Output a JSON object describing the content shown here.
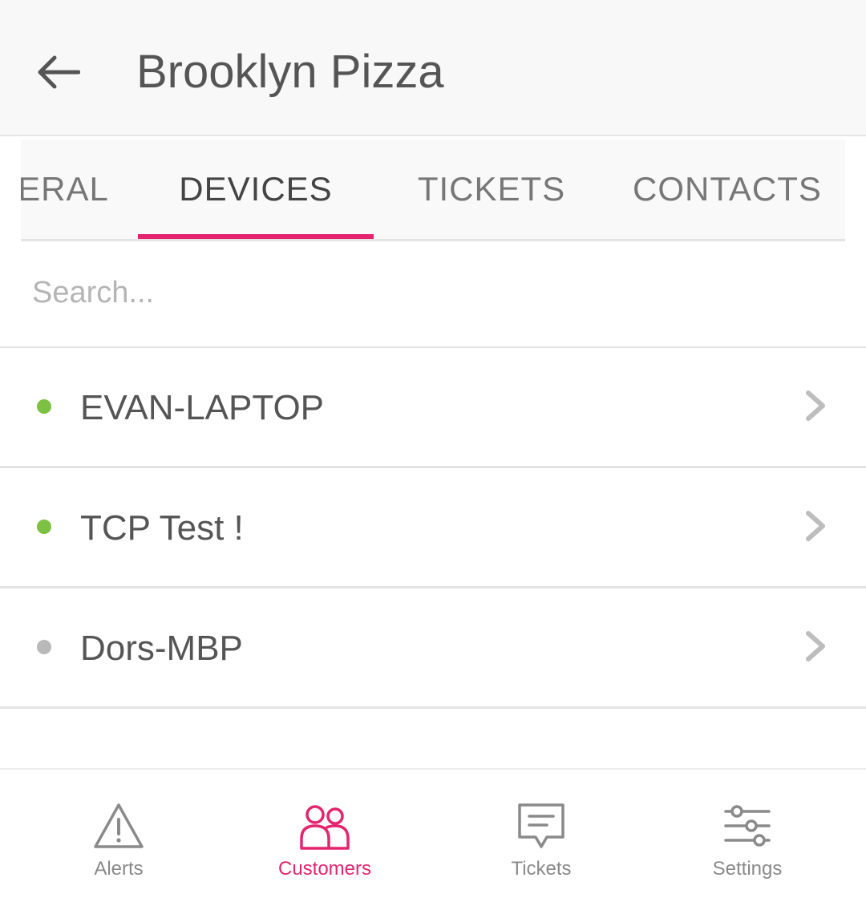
{
  "header": {
    "title": "Brooklyn Pizza",
    "back_icon": "arrow-left-icon"
  },
  "tabs": [
    {
      "label": "ERAL",
      "active": false
    },
    {
      "label": "DEVICES",
      "active": true
    },
    {
      "label": "TICKETS",
      "active": false
    },
    {
      "label": "CONTACTS",
      "active": false
    }
  ],
  "search": {
    "placeholder": "Search...",
    "value": ""
  },
  "devices": [
    {
      "name": "EVAN-LAPTOP",
      "status": "online",
      "status_color": "#7dc142"
    },
    {
      "name": "TCP Test !",
      "status": "online",
      "status_color": "#7dc142"
    },
    {
      "name": "Dors-MBP",
      "status": "offline",
      "status_color": "#b9b9b9"
    }
  ],
  "bottom_nav": [
    {
      "label": "Alerts",
      "icon": "warning-triangle-icon",
      "active": false
    },
    {
      "label": "Customers",
      "icon": "people-icon",
      "active": true
    },
    {
      "label": "Tickets",
      "icon": "chat-bubble-icon",
      "active": false
    },
    {
      "label": "Settings",
      "icon": "sliders-icon",
      "active": false
    }
  ],
  "colors": {
    "accent": "#e5246f",
    "online": "#7dc142",
    "offline": "#b9b9b9",
    "text": "#555555"
  }
}
